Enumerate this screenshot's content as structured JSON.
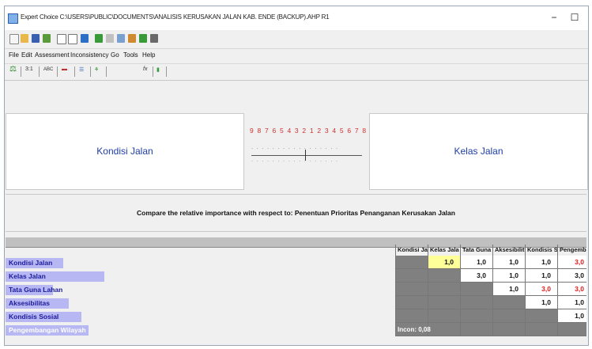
{
  "window": {
    "title": "Expert Choice   C:\\USERS\\PUBLIC\\DOCUMENTS\\ANALISIS KERUSAKAN JALAN KAB. ENDE (BACKUP).AHP   R1",
    "minimize": "−",
    "maximize": "☐"
  },
  "menu": [
    "File",
    "Edit",
    "Assessment",
    "Inconsistency",
    "Go",
    "Tools",
    "Help"
  ],
  "toolbar2": [
    "3:1",
    "ABC",
    "fx"
  ],
  "pairwise": {
    "left_element": "Kondisi Jalan",
    "right_element": "Kelas Jalan",
    "scale_numbers": "9 8 7 6 5 4 3 2 1 2 3 4 5 6 7 8 9",
    "scale_dots_top": ". . . . . . . . . . . . . . . . .",
    "scale_dots_bottom": ". . . . . . . . . . . . . . . . .",
    "selected_value": "1,0"
  },
  "compare_text": "Compare the relative importance with respect to: Penentuan Prioritas Penanganan Kerusakan Jalan",
  "matrix": {
    "columns": [
      "Kondisi Jal",
      "Kelas Jala",
      "Tata Guna",
      "Aksesibilit",
      "Kondisis S",
      "Pengemba"
    ],
    "rows": [
      {
        "label": "Kondisi Jalan",
        "values": [
          "",
          "1,0",
          "1,0",
          "1,0",
          "1,0",
          "3,0"
        ]
      },
      {
        "label": "Kelas Jalan",
        "values": [
          "",
          "",
          "3,0",
          "1,0",
          "1,0",
          "3,0"
        ]
      },
      {
        "label": "Tata Guna Lahan",
        "values": [
          "",
          "",
          "",
          "1,0",
          "3,0",
          "3,0"
        ]
      },
      {
        "label": "Aksesibilitas",
        "values": [
          "",
          "",
          "",
          "",
          "1,0",
          "1,0"
        ]
      },
      {
        "label": "Kondisis Sosial",
        "values": [
          "",
          "",
          "",
          "",
          "",
          "1,0"
        ]
      },
      {
        "label": "Pengembangan Wilayah",
        "values": [
          "",
          "",
          "",
          "",
          "",
          ""
        ]
      }
    ],
    "inconsistency": "Incon: 0,08"
  },
  "colors": {
    "label_blue": "#1e3ea8",
    "red_value": "#e21a1a",
    "row_band": "#b7b7f3",
    "selected_cell": "#ffff99"
  }
}
